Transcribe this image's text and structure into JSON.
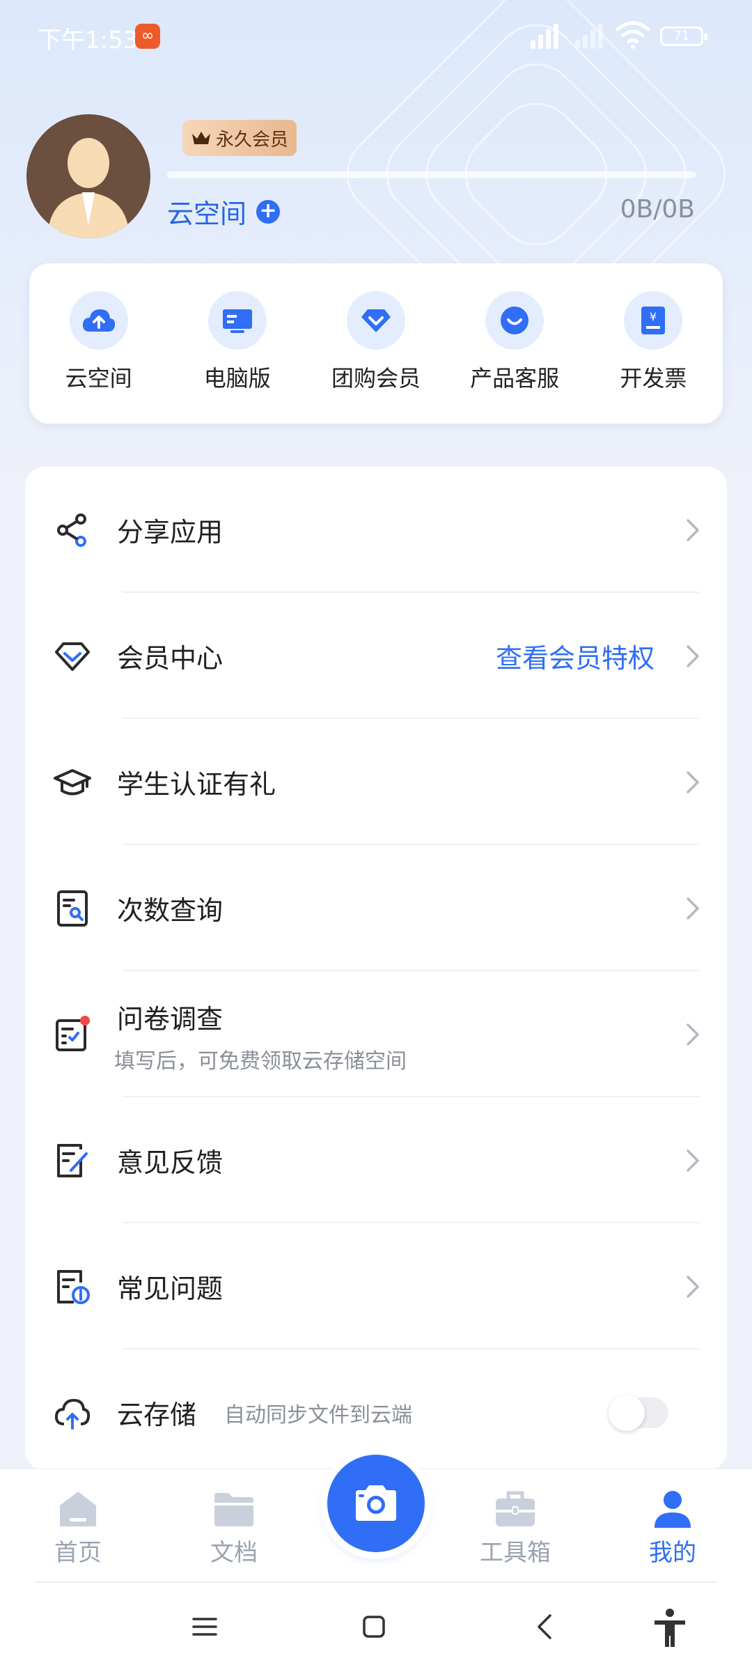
{
  "status_bar": {
    "time": "下午1:53",
    "battery": "71"
  },
  "profile": {
    "vip_label": "永久会员",
    "cloud_title": "云空间",
    "storage": "0B/0B",
    "usage_fraction": 0
  },
  "quick_actions": [
    {
      "label": "云空间",
      "icon": "cloud-upload-icon"
    },
    {
      "label": "电脑版",
      "icon": "computer-icon"
    },
    {
      "label": "团购会员",
      "icon": "diamond-icon"
    },
    {
      "label": "产品客服",
      "icon": "customer-service-icon"
    },
    {
      "label": "开发票",
      "icon": "invoice-icon"
    }
  ],
  "menu": [
    {
      "label": "分享应用",
      "icon": "share-icon"
    },
    {
      "label": "会员中心",
      "icon": "diamond-outline-icon",
      "extra": "查看会员特权"
    },
    {
      "label": "学生认证有礼",
      "icon": "graduation-cap-icon"
    },
    {
      "label": "次数查询",
      "icon": "search-document-icon"
    },
    {
      "label": "问卷调查",
      "icon": "survey-icon",
      "sub": "填写后，可免费领取云存储空间"
    },
    {
      "label": "意见反馈",
      "icon": "feedback-icon"
    },
    {
      "label": "常见问题",
      "icon": "faq-icon"
    }
  ],
  "cloud_storage": {
    "label": "云存储",
    "sub": "自动同步文件到云端",
    "enabled": false
  },
  "bottom_nav": [
    {
      "label": "首页",
      "icon": "home-icon"
    },
    {
      "label": "文档",
      "icon": "folder-icon"
    },
    {
      "label": "工具箱",
      "icon": "toolbox-icon"
    },
    {
      "label": "我的",
      "icon": "user-icon",
      "active": true
    }
  ],
  "colors": {
    "accent": "#2f6ef5",
    "vip_gold": "#e9b88f"
  }
}
